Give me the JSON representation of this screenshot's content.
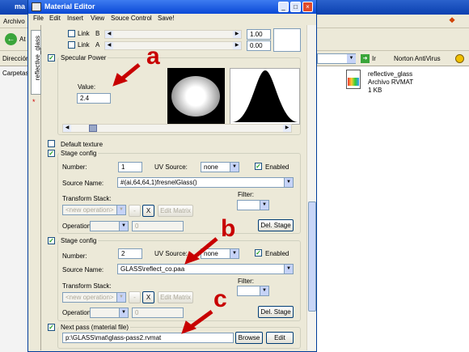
{
  "background_window": {
    "title_partial": "ma",
    "menu_partial": "Archivo",
    "back_partial": "At",
    "address_label": "Dirección",
    "folders_label": "Carpetas",
    "go_label": "Ir",
    "antivirus_label": "Norton AntiVirus",
    "file": {
      "name": "reflective_glass",
      "type": "Archivo RVMAT",
      "size": "1 KB"
    }
  },
  "editor": {
    "title": "Material Editor",
    "menu": [
      "File",
      "Edit",
      "Insert",
      "View",
      "Souce Control",
      "Save!"
    ],
    "side_tab": "reflective_glass",
    "side_marker": "*",
    "link_rows": [
      {
        "label": "Link",
        "letter": "B",
        "value": "1.00"
      },
      {
        "label": "Link",
        "letter": "A",
        "value": "0.00"
      }
    ],
    "specular": {
      "title": "Specular Power",
      "value_label": "Value:",
      "value": "2.4"
    },
    "default_texture_label": "Default texture",
    "stages": [
      {
        "title": "Stage config",
        "number_label": "Number:",
        "number": "1",
        "uv_label": "UV Source:",
        "uv": "none",
        "enabled_label": "Enabled",
        "source_label": "Source Name:",
        "source": "#(ai,64,64,1)fresnelGlass()",
        "transform_label": "Transform Stack:",
        "filter_label": "Filter:",
        "new_op": "<new operation>",
        "operation_label": "Operation",
        "operation_value": "0",
        "edit_matrix": "Edit Matrix",
        "del_stage": "Del. Stage"
      },
      {
        "title": "Stage config",
        "number_label": "Number:",
        "number": "2",
        "uv_label": "UV Source:",
        "uv": "none",
        "enabled_label": "Enabled",
        "source_label": "Source Name:",
        "source": "GLASS\\reflect_co.paa",
        "transform_label": "Transform Stack:",
        "filter_label": "Filter:",
        "new_op": "<new operation>",
        "operation_label": "Operation",
        "operation_value": "0",
        "edit_matrix": "Edit Matrix",
        "del_stage": "Del. Stage"
      }
    ],
    "next_pass": {
      "title": "Next pass (material file)",
      "path": "p:\\GLASS\\mat\\glass-pass2.rvmat",
      "browse": "Browse",
      "edit": "Edit"
    }
  },
  "annotations": [
    "a",
    "b",
    "c"
  ],
  "colors": {
    "annotation": "#c80000",
    "title_bar": "#0a49d6",
    "window_bg": "#ece9d8"
  }
}
